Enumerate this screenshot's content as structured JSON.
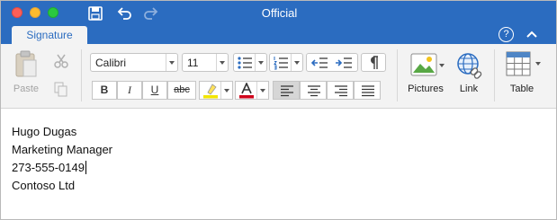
{
  "window": {
    "title": "Official"
  },
  "tabs": [
    {
      "label": "Signature"
    }
  ],
  "ribbon": {
    "clipboard": {
      "paste_label": "Paste"
    },
    "font": {
      "family": "Calibri",
      "size": "11"
    },
    "format_buttons": {
      "bold": "B",
      "italic": "I",
      "underline": "U",
      "strikethrough": "abc"
    },
    "insert": {
      "pictures_label": "Pictures",
      "link_label": "Link",
      "table_label": "Table"
    },
    "colors": {
      "highlight": "#f2e600",
      "font_color": "#d0021b"
    }
  },
  "help_label": "?",
  "signature_lines": [
    "Hugo Dugas",
    "Marketing Manager",
    "273-555-0149",
    "Contoso Ltd"
  ]
}
